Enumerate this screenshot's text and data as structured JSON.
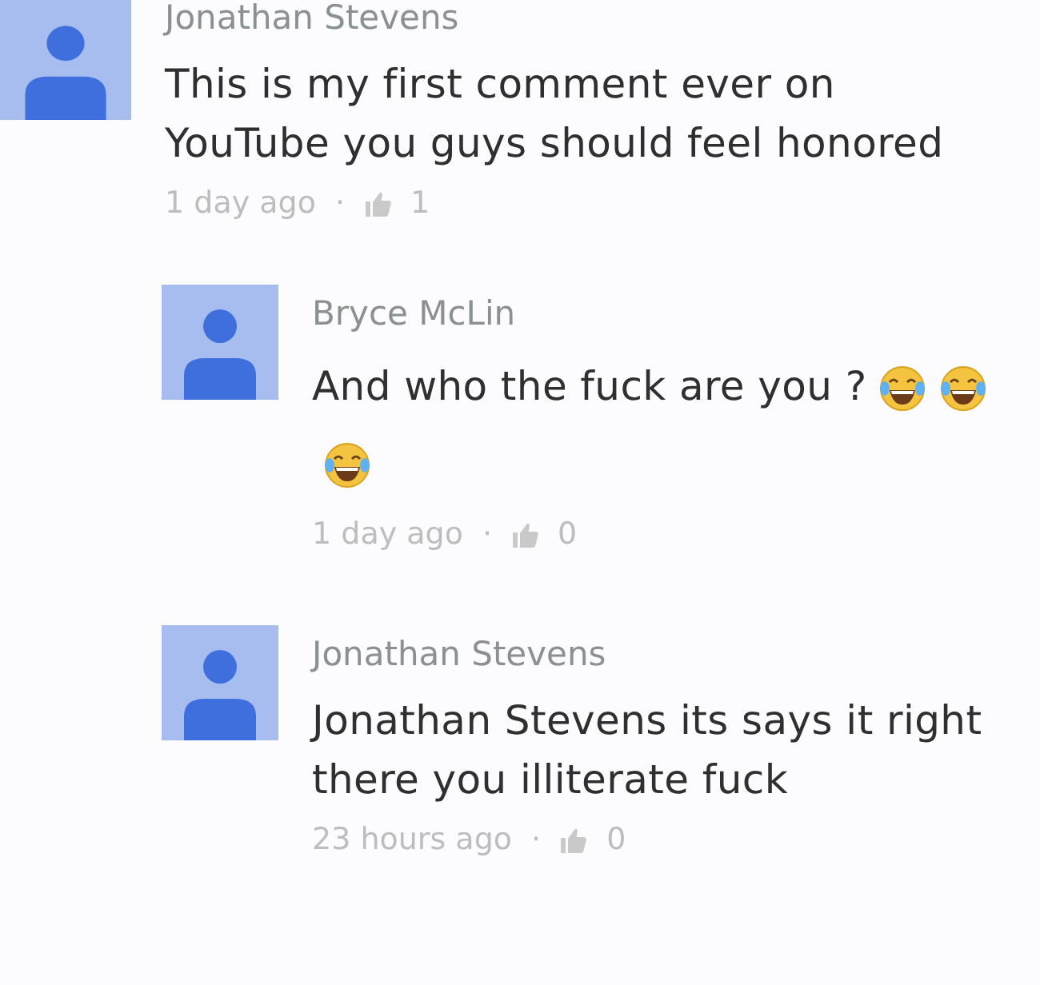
{
  "comments": [
    {
      "author": "Jonathan Stevens",
      "text": "This is my first comment ever on YouTube you guys should feel honored",
      "time": "1 day ago",
      "separator": "·",
      "likes": "1",
      "children": [
        {
          "author": "Bryce McLin",
          "text": "And who the fuck are you ?",
          "emojis": [
            {
              "kind": "laughing-crying"
            },
            {
              "kind": "laughing-crying"
            },
            {
              "kind": "laughing-crying"
            }
          ],
          "time": "1 day ago",
          "separator": "·",
          "likes": "0"
        },
        {
          "author": "Jonathan Stevens",
          "text": "Jonathan Stevens its says it right there you illiterate fuck",
          "time": "23 hours ago",
          "separator": "·",
          "likes": "0"
        }
      ]
    }
  ]
}
